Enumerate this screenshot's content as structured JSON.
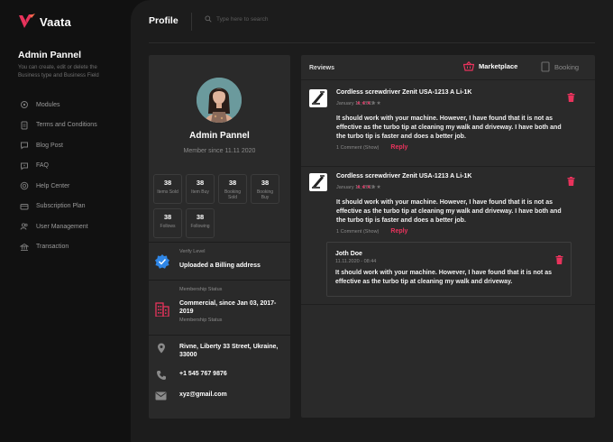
{
  "app": {
    "name": "Vaata"
  },
  "sidebar": {
    "title": "Admin Pannel",
    "description": "You can create, edit or delete the Business type and Business Field",
    "items": [
      {
        "label": "Modules",
        "icon": "gear-icon"
      },
      {
        "label": "Terms and Conditions",
        "icon": "document-icon"
      },
      {
        "label": "Blog Post",
        "icon": "chat-icon"
      },
      {
        "label": "FAQ",
        "icon": "chat-question-icon"
      },
      {
        "label": "Help Center",
        "icon": "help-icon"
      },
      {
        "label": "Subscription Plan",
        "icon": "card-icon"
      },
      {
        "label": "User Management",
        "icon": "users-icon"
      },
      {
        "label": "Transaction",
        "icon": "bank-icon"
      }
    ]
  },
  "header": {
    "title": "Profile",
    "search_placeholder": "Type here to search"
  },
  "profile": {
    "name": "Admin Pannel",
    "member_since": "Member since 11.11 2020",
    "stats": [
      {
        "value": "38",
        "label": "Items Sold"
      },
      {
        "value": "38",
        "label": "Item Buy"
      },
      {
        "value": "38",
        "label": "Booking Sold"
      },
      {
        "value": "38",
        "label": "Booking Buy"
      },
      {
        "value": "38",
        "label": "Follows"
      },
      {
        "value": "38",
        "label": "Following"
      }
    ],
    "verify": {
      "label": "Verify Level",
      "value": "Uploaded a Billing address"
    },
    "membership": {
      "label": "Membership Status",
      "value": "Commercial, since Jan 03, 2017-2019",
      "sublabel": "Membership Status"
    },
    "address": "Rivne, Liberty 33 Street, Ukraine, 33000",
    "phone": "+1 545 767 9876",
    "email": "xyz@gmail.com",
    "colors": {
      "accent": "#e8335c",
      "verify_badge": "#2f86e6"
    }
  },
  "reviews": {
    "title": "Reviews",
    "tabs": [
      {
        "label": "Marketplace",
        "active": true
      },
      {
        "label": "Booking",
        "active": false
      }
    ],
    "items": [
      {
        "product": "Cordless screwdriver Zenit USA-1213 A Li-1K",
        "date": "January 11, 2019",
        "rating": 3,
        "text": "It should work with your machine. However, I have found that it is not as effective as the turbo tip at cleaning my walk and driveway. I have both and the turbo tip is faster and does a better job.",
        "comments": "1 Comment (Show)",
        "reply_label": "Reply"
      },
      {
        "product": "Cordless screwdriver Zenit USA-1213 A Li-1K",
        "date": "January 11, 2019",
        "rating": 3,
        "text": "It should work with your machine. However, I have found that it is not as effective as the turbo tip at cleaning my walk and driveway. I have both and the turbo tip is faster and does a better job.",
        "comments": "1 Comment (Show)",
        "reply_label": "Reply"
      }
    ],
    "reply": {
      "author": "Joth Doe",
      "date": "11.11.2020 - 08:44",
      "text": "It should work with your machine. However, I have found that it is not as effective as the turbo tip at cleaning my walk and driveway."
    }
  }
}
